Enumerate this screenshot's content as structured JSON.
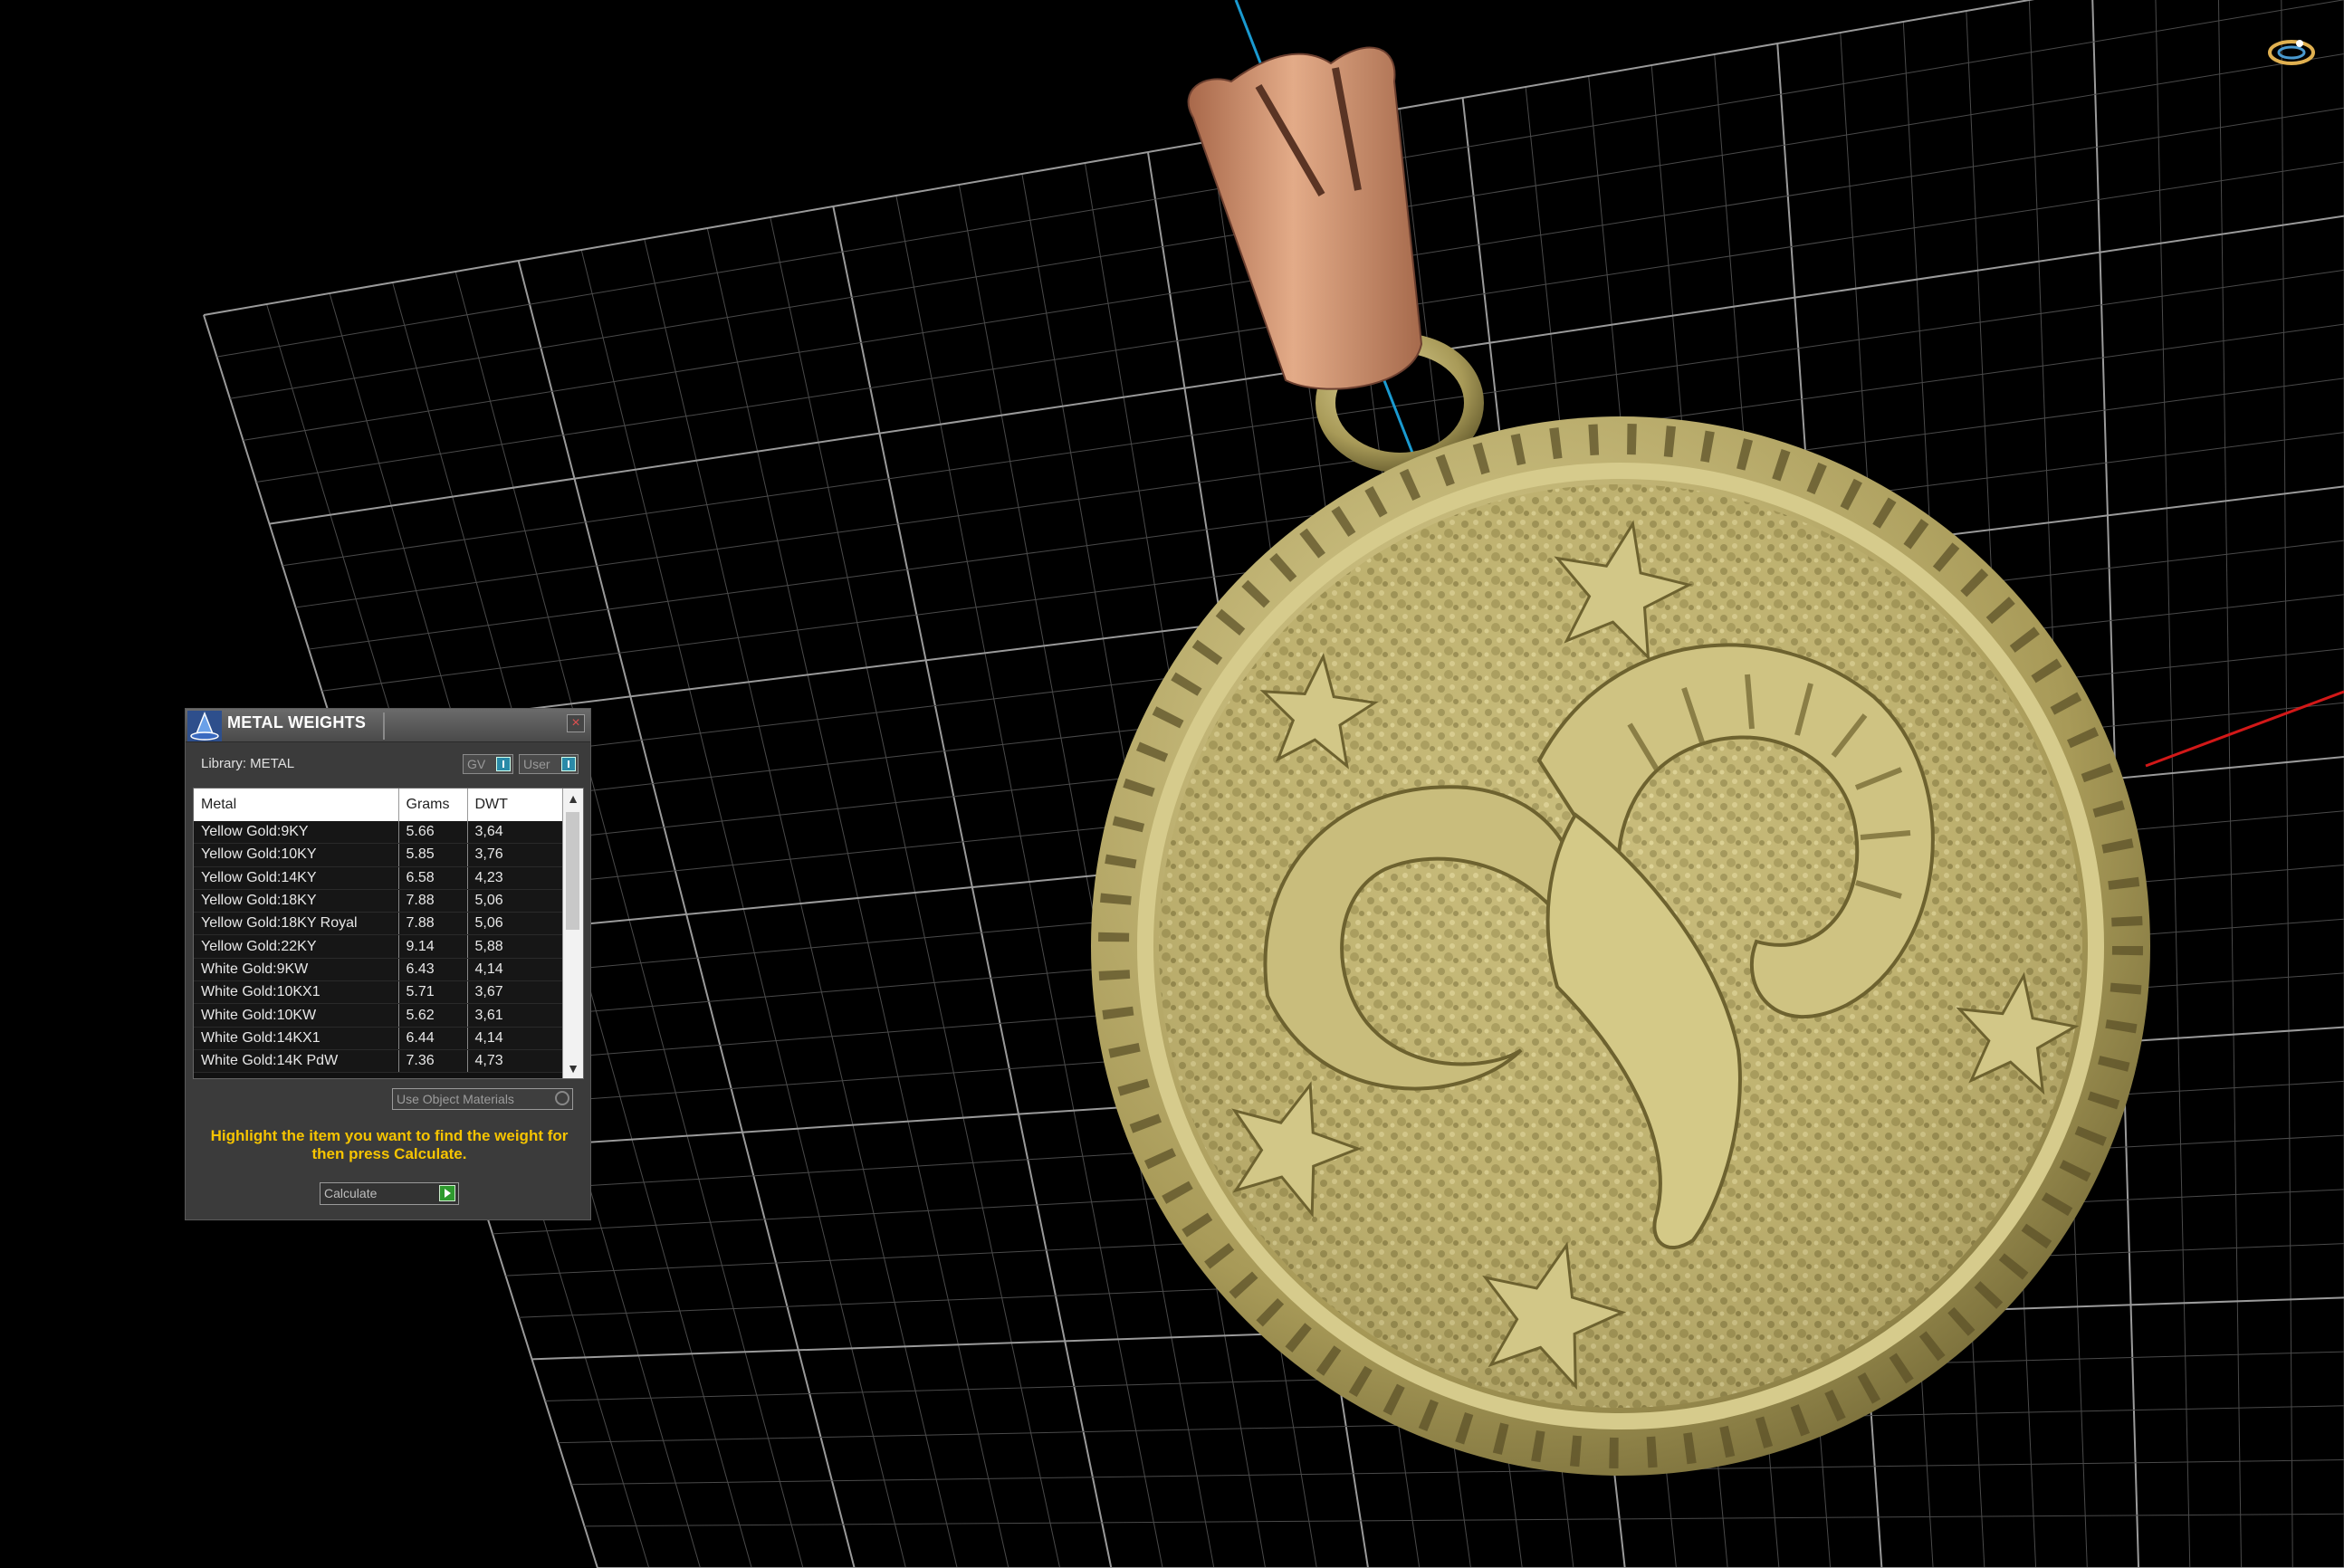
{
  "panel": {
    "title": "METAL WEIGHTS",
    "close_glyph": "×",
    "library_label": "Library: METAL",
    "gv_label": "GV",
    "user_label": "User",
    "columns": [
      "Metal",
      "Grams",
      "DWT"
    ],
    "rows": [
      {
        "metal": "Yellow Gold:9KY",
        "grams": "5.66",
        "dwt": "3,64"
      },
      {
        "metal": "Yellow Gold:10KY",
        "grams": "5.85",
        "dwt": "3,76"
      },
      {
        "metal": "Yellow Gold:14KY",
        "grams": "6.58",
        "dwt": "4,23"
      },
      {
        "metal": "Yellow Gold:18KY",
        "grams": "7.88",
        "dwt": "5,06"
      },
      {
        "metal": "Yellow Gold:18KY Royal",
        "grams": "7.88",
        "dwt": "5,06"
      },
      {
        "metal": "Yellow Gold:22KY",
        "grams": "9.14",
        "dwt": "5,88"
      },
      {
        "metal": "White Gold:9KW",
        "grams": "6.43",
        "dwt": "4,14"
      },
      {
        "metal": "White Gold:10KX1",
        "grams": "5.71",
        "dwt": "3,67"
      },
      {
        "metal": "White Gold:10KW",
        "grams": "5.62",
        "dwt": "3,61"
      },
      {
        "metal": "White Gold:14KX1",
        "grams": "6.44",
        "dwt": "4,14"
      },
      {
        "metal": "White Gold:14K PdW",
        "grams": "7.36",
        "dwt": "4,73"
      }
    ],
    "use_object_materials": "Use Object Materials",
    "hint": "Highlight the item you want to find the weight for then press Calculate.",
    "calculate_label": "Calculate",
    "scroll_up_glyph": "▲",
    "scroll_down_glyph": "▼"
  },
  "colors": {
    "background": "#000000",
    "grid": "#7a7a7a",
    "gold": "#b8ab6a",
    "rose_gold": "#c8906a",
    "axis_x": "#d21818",
    "axis_y": "#1a9ad0",
    "hint_text": "#f6c400"
  },
  "icons": {
    "panel_logo": "wizard-hat-icon",
    "close": "close-icon",
    "gv_indicator": "toggle-indicator-icon",
    "user_indicator": "toggle-indicator-icon",
    "use_object_gear": "gear-icon",
    "calculate_go": "play-icon",
    "navigation": "ring-navigation-icon"
  }
}
